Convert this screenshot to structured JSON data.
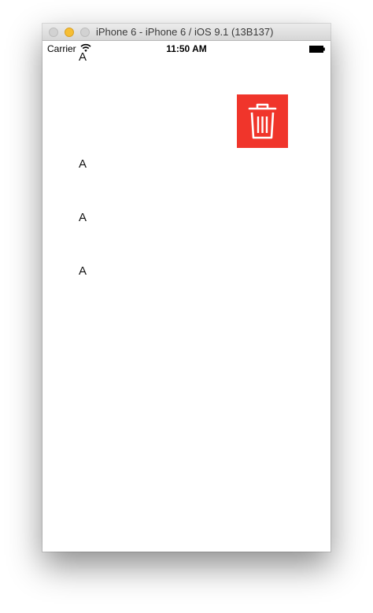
{
  "window": {
    "title": "iPhone 6 - iPhone 6 / iOS 9.1 (13B137)"
  },
  "status_bar": {
    "carrier": "Carrier",
    "time": "11:50 AM"
  },
  "rows": [
    {
      "label": "A"
    },
    {
      "label": "A"
    },
    {
      "label": "A"
    },
    {
      "label": "A"
    }
  ],
  "delete_action": {
    "icon": "trash-icon",
    "color": "#f0352b"
  }
}
